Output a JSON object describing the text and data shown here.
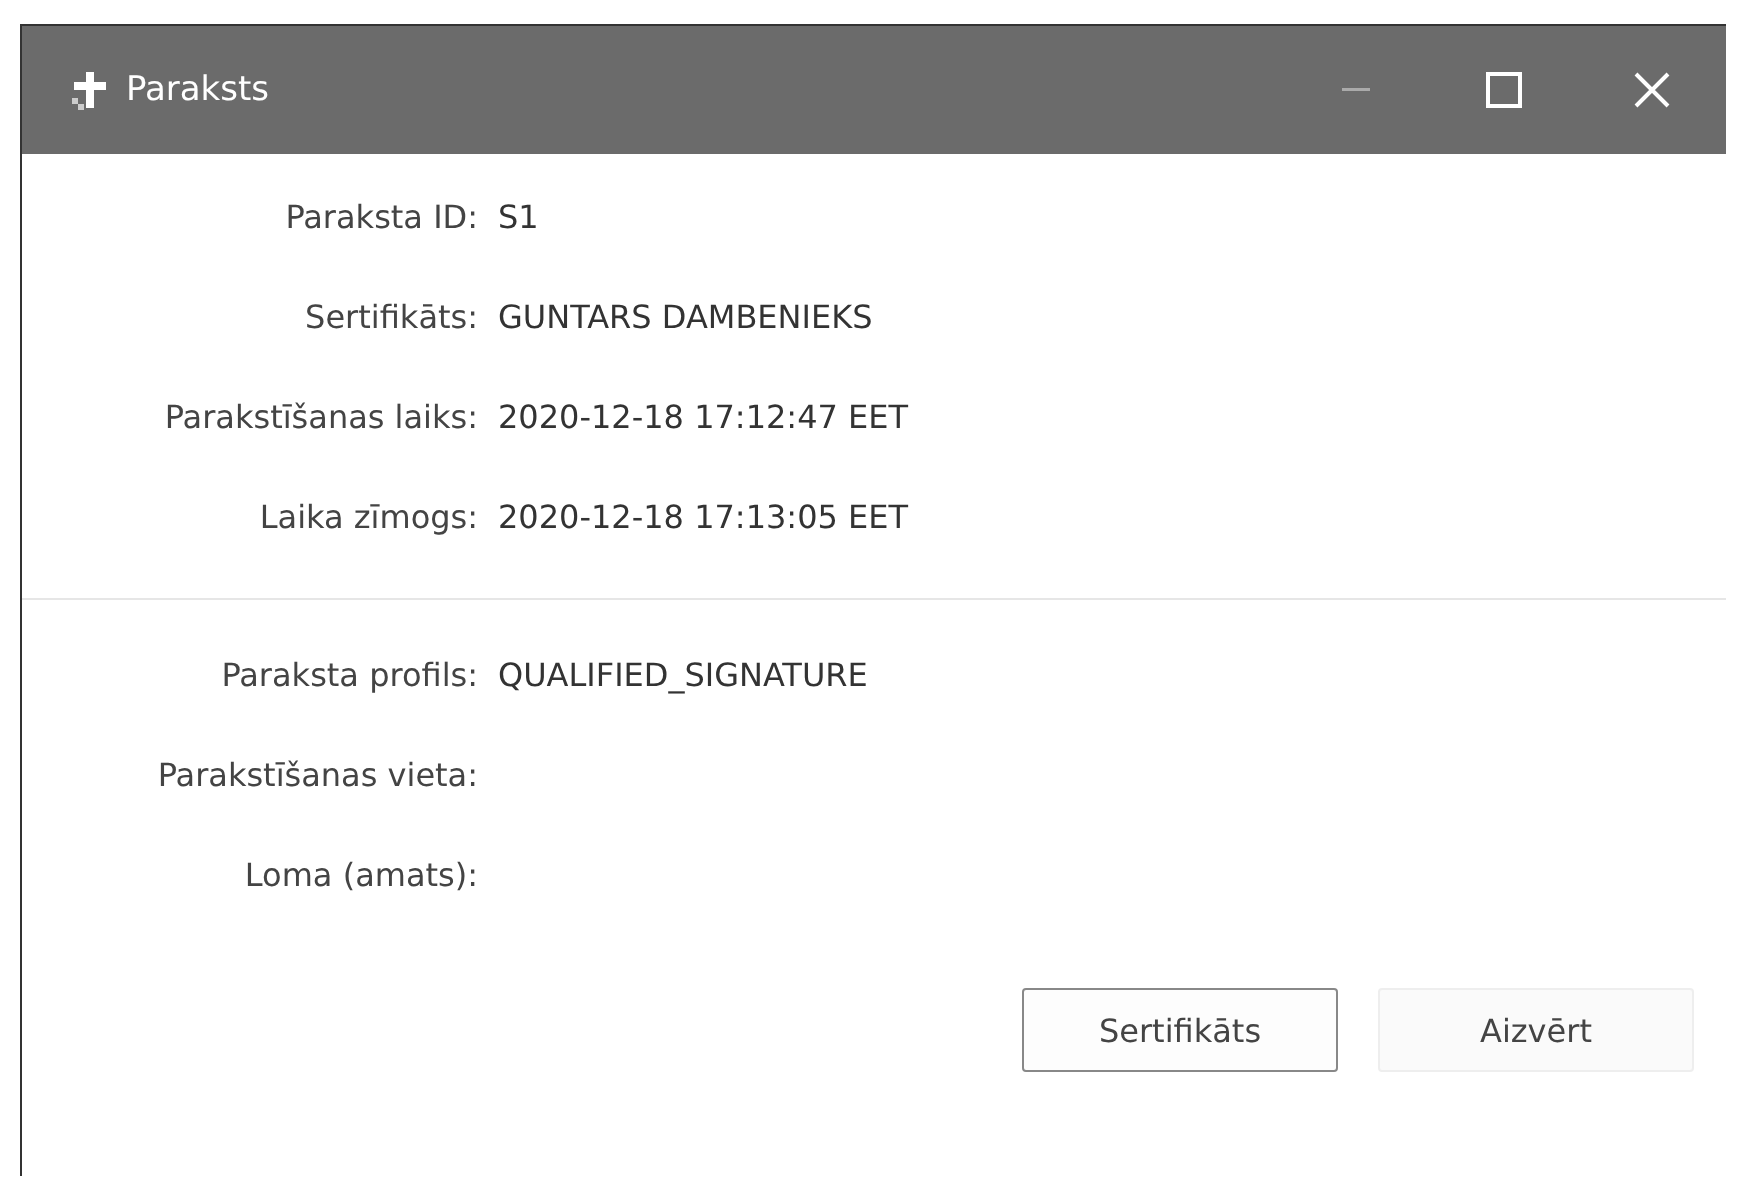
{
  "window": {
    "title": "Paraksts"
  },
  "sections": [
    {
      "rows": [
        {
          "label": "Paraksta ID:",
          "value": "S1"
        },
        {
          "label": "Sertifikāts:",
          "value": "GUNTARS DAMBENIEKS"
        },
        {
          "label": "Parakstīšanas laiks:",
          "value": "2020-12-18 17:12:47 EET"
        },
        {
          "label": "Laika zīmogs:",
          "value": "2020-12-18 17:13:05 EET"
        }
      ]
    },
    {
      "rows": [
        {
          "label": "Paraksta profils:",
          "value": "QUALIFIED_SIGNATURE"
        },
        {
          "label": "Parakstīšanas vieta:"
        },
        {
          "label": "Loma (amats):"
        }
      ]
    }
  ],
  "buttons": [
    {
      "label": "Sertifikāts",
      "focused": true
    },
    {
      "label": "Aizvērt",
      "focused": false
    }
  ]
}
